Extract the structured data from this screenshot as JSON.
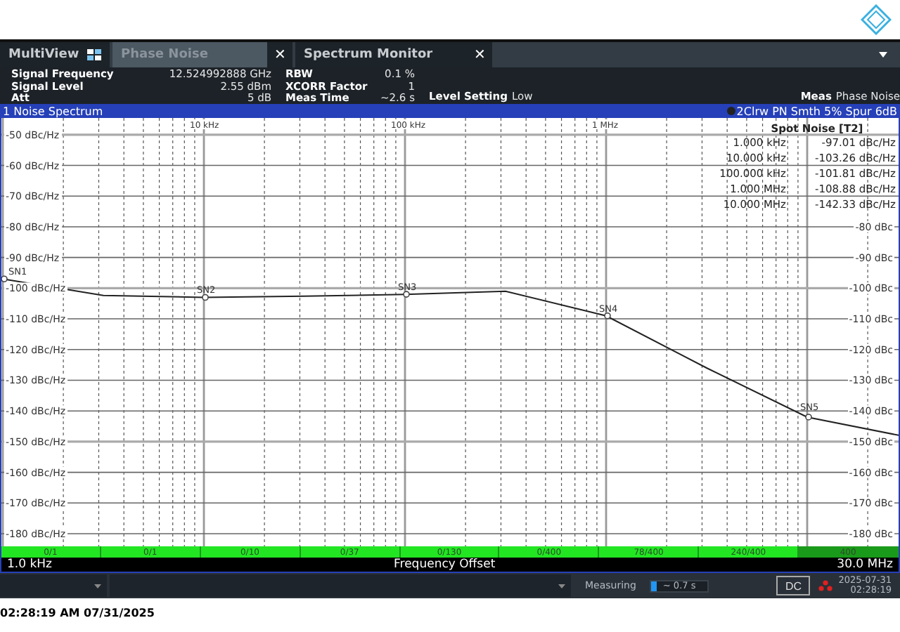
{
  "tabs": [
    {
      "label": "MultiView",
      "kind": "overview",
      "selected": false
    },
    {
      "label": "Phase Noise",
      "kind": "closable",
      "selected": true
    },
    {
      "label": "Spectrum Monitor",
      "kind": "closable",
      "selected": false
    }
  ],
  "close_glyph": "✕",
  "info": {
    "col1": [
      {
        "label": "Signal Frequency",
        "value": "12.524992888 GHz"
      },
      {
        "label": "Signal Level",
        "value": "2.55 dBm"
      },
      {
        "label": "Att",
        "value": "5 dB"
      }
    ],
    "col2": [
      {
        "label": "RBW",
        "value": "0.1 %"
      },
      {
        "label": "XCORR Factor",
        "value": "1"
      },
      {
        "label": "Meas Time",
        "value": "~2.6 s"
      }
    ],
    "level_setting": {
      "label": "Level Setting",
      "value": "Low"
    },
    "meas": {
      "label": "Meas",
      "value": "Phase Noise"
    }
  },
  "window": {
    "title": "1 Noise Spectrum",
    "trace_info": "2Clrw PN Smth 5% Spur 6dB"
  },
  "chart": {
    "chart_data": {
      "type": "line",
      "categories": [
        null,
        null,
        "10 kHz",
        null,
        "100 kHz",
        null,
        "1 MHz",
        null,
        null,
        null
      ],
      "series": [
        {
          "color": "#222222",
          "values": [
            -97,
            -102.4,
            -103,
            -102.6,
            -102,
            -101,
            -109,
            -126,
            -142,
            -148
          ]
        }
      ],
      "grid": true,
      "ylim": [
        -180,
        -45
      ],
      "yticks": [
        {
          "value": -50,
          "label": "-50 dBc/Hz"
        },
        {
          "value": -60,
          "label": "-60 dBc/Hz"
        },
        {
          "value": -70,
          "label": "-70 dBc/Hz"
        },
        {
          "value": -80,
          "label": "-80 dBc/Hz"
        },
        {
          "value": -90,
          "label": "-90 dBc/Hz"
        },
        {
          "value": -100,
          "label": "-100 dBc/Hz"
        },
        {
          "value": -110,
          "label": "-110 dBc/Hz"
        },
        {
          "value": -120,
          "label": "-120 dBc/Hz"
        },
        {
          "value": -130,
          "label": "-130 dBc/Hz"
        },
        {
          "value": -140,
          "label": "-140 dBc/Hz"
        },
        {
          "value": -150,
          "label": "-150 dBc/Hz"
        },
        {
          "value": -160,
          "label": "-160 dBc/Hz"
        },
        {
          "value": -170,
          "label": "-170 dBc/Hz"
        },
        {
          "value": -180,
          "label": "-180 dBc/Hz"
        }
      ],
      "annotations": [
        {
          "text": "SN1",
          "y": -97
        },
        {
          "text": "SN2",
          "y": -103
        },
        {
          "text": "SN3",
          "y": -102
        },
        {
          "text": "SN4",
          "y": -109
        },
        {
          "text": "SN5",
          "y": -142
        }
      ]
    },
    "right_labels": [
      "-80 dBc",
      "-90 dBc",
      "-100 dBc",
      "-110 dBc",
      "-120 dBc",
      "-130 dBc",
      "-140 dBc",
      "-150 dBc",
      "-160 dBc",
      "-170 dBc",
      "-180 dBc"
    ],
    "spot_noise": {
      "title": "Spot Noise [T2]",
      "rows": [
        {
          "offset": "1.000 kHz",
          "value": "-97.01 dBc/Hz"
        },
        {
          "offset": "10.000 kHz",
          "value": "-103.26 dBc/Hz"
        },
        {
          "offset": "100.000 kHz",
          "value": "-101.81 dBc/Hz"
        },
        {
          "offset": "1.000 MHz",
          "value": "-108.88 dBc/Hz"
        },
        {
          "offset": "10.000 MHz",
          "value": "-142.33 dBc/Hz"
        }
      ]
    }
  },
  "progress_segments": [
    {
      "label": "0/1",
      "complete": false
    },
    {
      "label": "0/1",
      "complete": false
    },
    {
      "label": "0/10",
      "complete": false
    },
    {
      "label": "0/37",
      "complete": false
    },
    {
      "label": "0/130",
      "complete": false
    },
    {
      "label": "0/400",
      "complete": false
    },
    {
      "label": "78/400",
      "complete": false
    },
    {
      "label": "240/400",
      "complete": false
    },
    {
      "label": "400",
      "complete": true
    }
  ],
  "axis": {
    "start": "1.0 kHz",
    "title": "Frequency Offset",
    "stop": "30.0 MHz"
  },
  "status_bar": {
    "status": "Measuring",
    "progress": {
      "level": 0.1,
      "reading": "~ 0.7 s"
    },
    "dc_button": "DC",
    "date": "2025-07-31",
    "time": "02:28:19"
  },
  "timestamp": "02:28:19 AM  07/31/2025"
}
